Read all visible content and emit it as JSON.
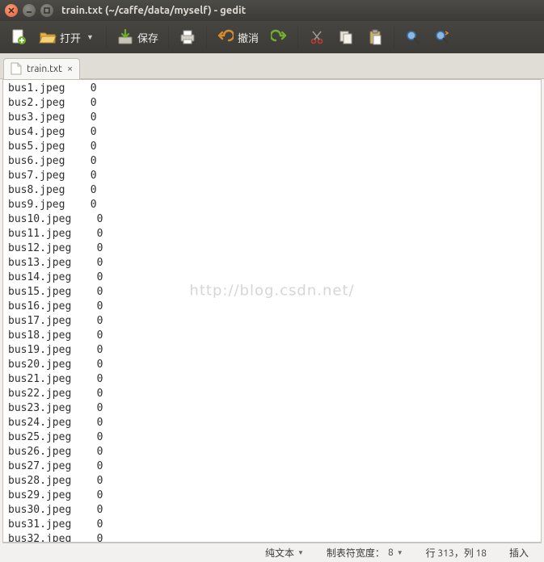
{
  "window": {
    "title": "train.txt (~/caffe/data/myself) - gedit"
  },
  "toolbar": {
    "open_label": "打开",
    "save_label": "保存",
    "undo_label": "撤消"
  },
  "tab": {
    "label": "train.txt"
  },
  "editor": {
    "lines": [
      "bus1.jpeg    0",
      "bus2.jpeg    0",
      "bus3.jpeg    0",
      "bus4.jpeg    0",
      "bus5.jpeg    0",
      "bus6.jpeg    0",
      "bus7.jpeg    0",
      "bus8.jpeg    0",
      "bus9.jpeg    0",
      "bus10.jpeg    0",
      "bus11.jpeg    0",
      "bus12.jpeg    0",
      "bus13.jpeg    0",
      "bus14.jpeg    0",
      "bus15.jpeg    0",
      "bus16.jpeg    0",
      "bus17.jpeg    0",
      "bus18.jpeg    0",
      "bus19.jpeg    0",
      "bus20.jpeg    0",
      "bus21.jpeg    0",
      "bus22.jpeg    0",
      "bus23.jpeg    0",
      "bus24.jpeg    0",
      "bus25.jpeg    0",
      "bus26.jpeg    0",
      "bus27.jpeg    0",
      "bus28.jpeg    0",
      "bus29.jpeg    0",
      "bus30.jpeg    0",
      "bus31.jpeg    0",
      "bus32.jpeg    0"
    ]
  },
  "watermark": "http://blog.csdn.net/",
  "statusbar": {
    "syntax": "纯文本",
    "tabwidth_label": "制表符宽度：",
    "tabwidth_value": "8",
    "position": "行 313，列 18",
    "mode": "插入"
  }
}
